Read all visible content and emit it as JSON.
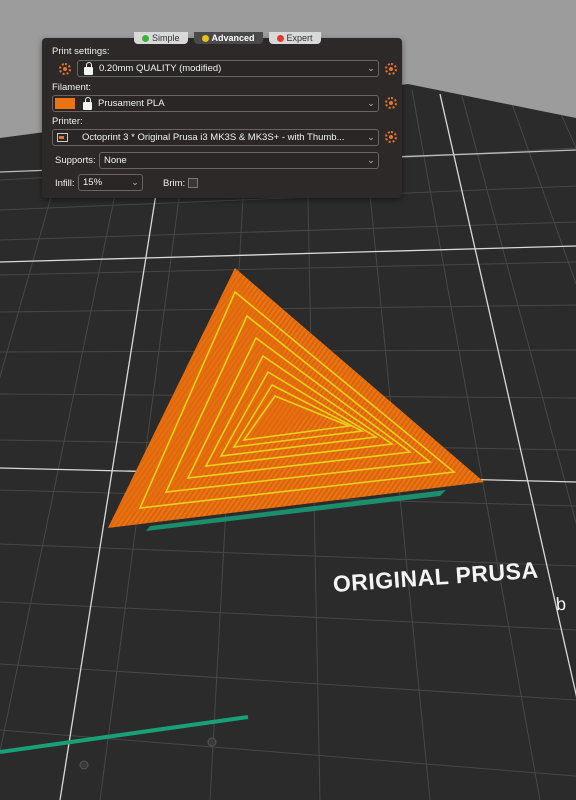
{
  "mode_tabs": [
    {
      "label": "Simple",
      "color": "#3bb33b"
    },
    {
      "label": "Advanced",
      "color": "#e6c21c"
    },
    {
      "label": "Expert",
      "color": "#e03a2a"
    }
  ],
  "print_settings": {
    "label": "Print settings:",
    "value": "0.20mm QUALITY (modified)"
  },
  "filament": {
    "label": "Filament:",
    "value": "Prusament PLA",
    "color": "#ec7312"
  },
  "printer": {
    "label": "Printer:",
    "value": "Octoprint 3 * Original Prusa i3 MK3S & MK3S+ - with Thumb..."
  },
  "supports": {
    "label": "Supports:",
    "value": "None"
  },
  "infill": {
    "label": "Infill:",
    "value": "15%"
  },
  "brim": {
    "label": "Brim:"
  },
  "bed": {
    "brand_text": "ORIGINAL PRUSA",
    "sub_text": "b"
  },
  "colors": {
    "accent": "#e8742a",
    "model": "#ec7312",
    "infill_lines": "#e6d21c",
    "bed": "#2b2b2b",
    "background": "#9c9c9c"
  }
}
